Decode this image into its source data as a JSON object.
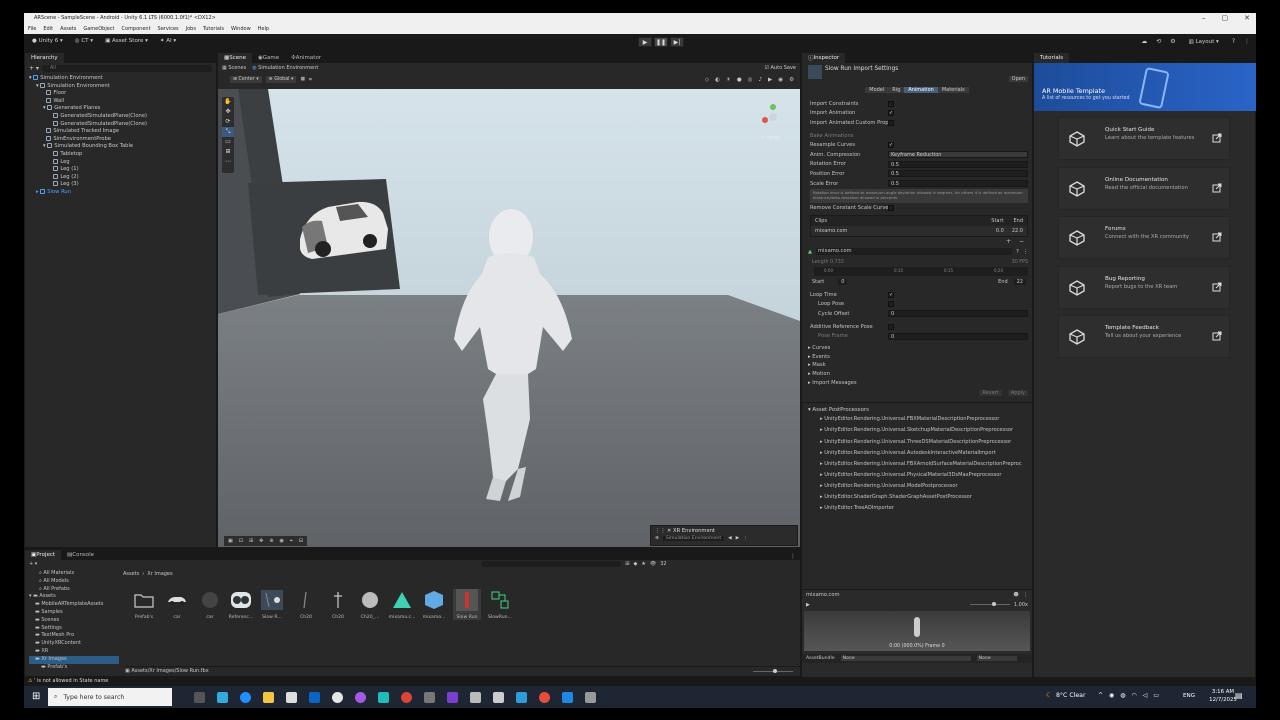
{
  "window": {
    "title": "ARScene - SampleScene - Android - Unity 6.1 LTS (6000.1.0f1)* <DX12>"
  },
  "menu": [
    "File",
    "Edit",
    "Assets",
    "GameObject",
    "Component",
    "Services",
    "Jobs",
    "Tutorials",
    "Window",
    "Help"
  ],
  "toolbar": {
    "account": "Unity 6",
    "ct": "CT",
    "asset_store": "Asset Store",
    "ai": "AI",
    "layout": "Layout"
  },
  "hierarchy": {
    "tab": "Hierarchy",
    "search_placeholder": "All",
    "items": [
      {
        "label": "Simulation Environment",
        "depth": 0,
        "selected": false
      },
      {
        "label": "Simulation Environment",
        "depth": 1,
        "selected": false
      },
      {
        "label": "Floor",
        "depth": 2,
        "selected": false
      },
      {
        "label": "Wall",
        "depth": 2,
        "selected": false
      },
      {
        "label": "Generated Planes",
        "depth": 2,
        "selected": false
      },
      {
        "label": "GeneratedSimulatedPlane(Clone)",
        "depth": 3,
        "selected": false
      },
      {
        "label": "GeneratedSimulatedPlane(Clone)",
        "depth": 3,
        "selected": false
      },
      {
        "label": "Simulated Tracked Image",
        "depth": 2,
        "selected": false
      },
      {
        "label": "SimEnvironmentProbe",
        "depth": 2,
        "selected": false
      },
      {
        "label": "Simulated Bounding Box Table",
        "depth": 2,
        "selected": false
      },
      {
        "label": "Tabletop",
        "depth": 3,
        "selected": false
      },
      {
        "label": "Leg",
        "depth": 3,
        "selected": false
      },
      {
        "label": "Leg (1)",
        "depth": 3,
        "selected": false
      },
      {
        "label": "Leg (2)",
        "depth": 3,
        "selected": false
      },
      {
        "label": "Leg (3)",
        "depth": 3,
        "selected": false
      },
      {
        "label": "Slow Run",
        "depth": 1,
        "selected": true
      }
    ]
  },
  "scene": {
    "tabs": [
      "Scene",
      "Game",
      "Animator"
    ],
    "breadcrumb_scenes": "Scenes",
    "breadcrumb_env": "Simulation Environment",
    "auto_save": "Auto Save",
    "center": "Center",
    "global": "Global",
    "persp": "< Persp",
    "xr_env": "XR Environment",
    "xr_env_dropdown": "Simulation Environment"
  },
  "inspector": {
    "tab": "Inspector",
    "title": "Slow Run Import Settings",
    "open": "Open",
    "tabs": [
      "Model",
      "Rig",
      "Animation",
      "Materials"
    ],
    "active_tab": "Animation",
    "fields": {
      "import_constraints": "Import Constraints",
      "import_animation": "Import Animation",
      "import_custom": "Import Animated Custom Prope",
      "bake_animations": "Bake Animations",
      "resample_curves": "Resample Curves",
      "anim_compression": "Anim. Compression",
      "anim_compression_value": "Keyframe Reduction",
      "rotation_error": "Rotation Error",
      "rotation_error_value": "0.5",
      "position_error": "Position Error",
      "position_error_value": "0.5",
      "scale_error": "Scale Error",
      "scale_error_value": "0.5",
      "help_text": "Rotation error is defined as maximum angle deviation allowed in degrees, for others it is defined as maximum distance/delta deviation allowed in percents",
      "remove_constant": "Remove Constant Scale Curves"
    },
    "clips": {
      "header": "Clips",
      "start": "Start",
      "end": "End",
      "name": "mixamo.com",
      "start_val": "0.0",
      "end_val": "22.0"
    },
    "clip_name": "mixamo.com",
    "length_label": "Length",
    "length_value": "0.733",
    "fps": "30 FPS",
    "timeline_ticks": [
      "0:00",
      "0:10",
      "0:15",
      "0:20"
    ],
    "start_label": "Start",
    "start_value": "0",
    "end_label": "End",
    "end_value": "22",
    "loop_time": "Loop Time",
    "loop_pose": "Loop Pose",
    "cycle_offset": "Cycle Offset",
    "cycle_offset_value": "0",
    "additive": "Additive Reference Pose",
    "pose_frame": "Pose Frame",
    "pose_frame_value": "0",
    "foldouts": [
      "Curves",
      "Events",
      "Mask",
      "Motion",
      "Import Messages"
    ],
    "revert": "Revert",
    "apply": "Apply",
    "postprocessors_title": "Asset PostProcessors",
    "postprocessors": [
      "UnityEditor.Rendering.Universal.FBXMaterialDescriptionPreprocessor",
      "UnityEditor.Rendering.Universal.SketchupMaterialDescriptionPreprocessor",
      "UnityEditor.Rendering.Universal.ThreeDSMaterialDescriptionPreprocessor",
      "UnityEditor.Rendering.Universal.AutodeskInteractiveMaterialImport",
      "UnityEditor.Rendering.Universal.FBXArnoldSurfaceMaterialDescriptionPreproc",
      "UnityEditor.Rendering.Universal.PhysicalMaterial3DsMaxPreprocessor",
      "UnityEditor.Rendering.Universal.ModelPostprocessor",
      "UnityEditor.ShaderGraph.ShaderGraphAssetPostProcessor",
      "UnityEditor.TreeAOImporter"
    ],
    "preview_name": "mixamo.com",
    "preview_speed": "1.00x",
    "preview_time": "0:00 (000.0%) Frame 0",
    "asset_bundle": "AssetBundle",
    "asset_bundle_value": "None",
    "asset_bundle_variant": "None"
  },
  "tutorials": {
    "tab": "Tutorials",
    "banner_title": "AR Mobile Template",
    "banner_sub": "A list of resources to get you started",
    "cards": [
      {
        "title": "Quick Start Guide",
        "desc": "Learn about the template features"
      },
      {
        "title": "Online Documentation",
        "desc": "Read the official documentation"
      },
      {
        "title": "Forums",
        "desc": "Connect with the XR community"
      },
      {
        "title": "Bug Reporting",
        "desc": "Report bugs to the XR team"
      },
      {
        "title": "Template Feedback",
        "desc": "Tell us about your experience"
      }
    ]
  },
  "project": {
    "tabs": [
      "Project",
      "Console"
    ],
    "count": "32",
    "tree": [
      "All Materials",
      "All Models",
      "All Prefabs",
      "Assets",
      "MobileARTemplateAssets",
      "Samples",
      "Scenes",
      "Settings",
      "TextMesh Pro",
      "UnityXRContent",
      "XR",
      "Xr Images",
      "Prefab's"
    ],
    "breadcrumb_root": "Assets",
    "breadcrumb_folder": "Xr Images",
    "assets": [
      "Prefab's",
      "car",
      "car",
      "Referenc...",
      "Slow R...",
      "Ch20",
      "Ch20",
      "Ch20_...",
      "mixamo.c...",
      "mixamo...",
      "Slow Run",
      "SlowRun..."
    ],
    "status_path": "Assets/Xr Images/Slow Run.fbx",
    "error": "' is not allowed in State name"
  },
  "taskbar": {
    "search": "Type here to search",
    "weather": "8°C  Clear",
    "lang": "ENG",
    "time": "3:16 AM",
    "date": "12/7/2025"
  },
  "colors": {
    "accent": "#4fa3ff",
    "panel": "#282828",
    "dark": "#191919",
    "taskbar": "#1e2533"
  }
}
